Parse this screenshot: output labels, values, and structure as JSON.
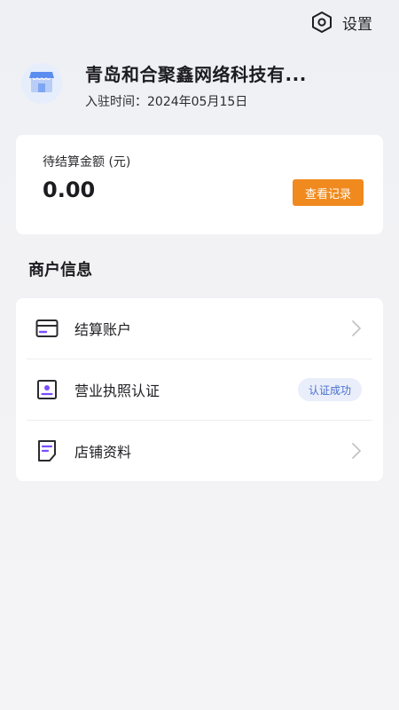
{
  "header": {
    "settings_icon": "settings-hexagon-icon",
    "settings_label": "设置"
  },
  "merchant": {
    "avatar_icon": "storefront-icon",
    "name": "青岛和合聚鑫网络科技有...",
    "join_label": "入驻时间：",
    "join_date": "2024年05月15日"
  },
  "balance": {
    "label": "待结算金额 (元)",
    "value": "0.00",
    "record_button": "查看记录",
    "accent": "#f08a1e"
  },
  "merchant_info": {
    "title": "商户信息",
    "items": [
      {
        "icon": "card-icon",
        "label": "结算账户",
        "trailing": "chevron-right-icon"
      },
      {
        "icon": "id-badge-icon",
        "label": "营业执照认证",
        "status": "认证成功"
      },
      {
        "icon": "document-icon",
        "label": "店铺资料",
        "trailing": "chevron-right-icon"
      }
    ]
  },
  "colors": {
    "icon_outline": "#2a2a30",
    "icon_accent": "#7a4dff",
    "badge_text": "#4a6fd0",
    "badge_bg": "#e9eefa"
  }
}
